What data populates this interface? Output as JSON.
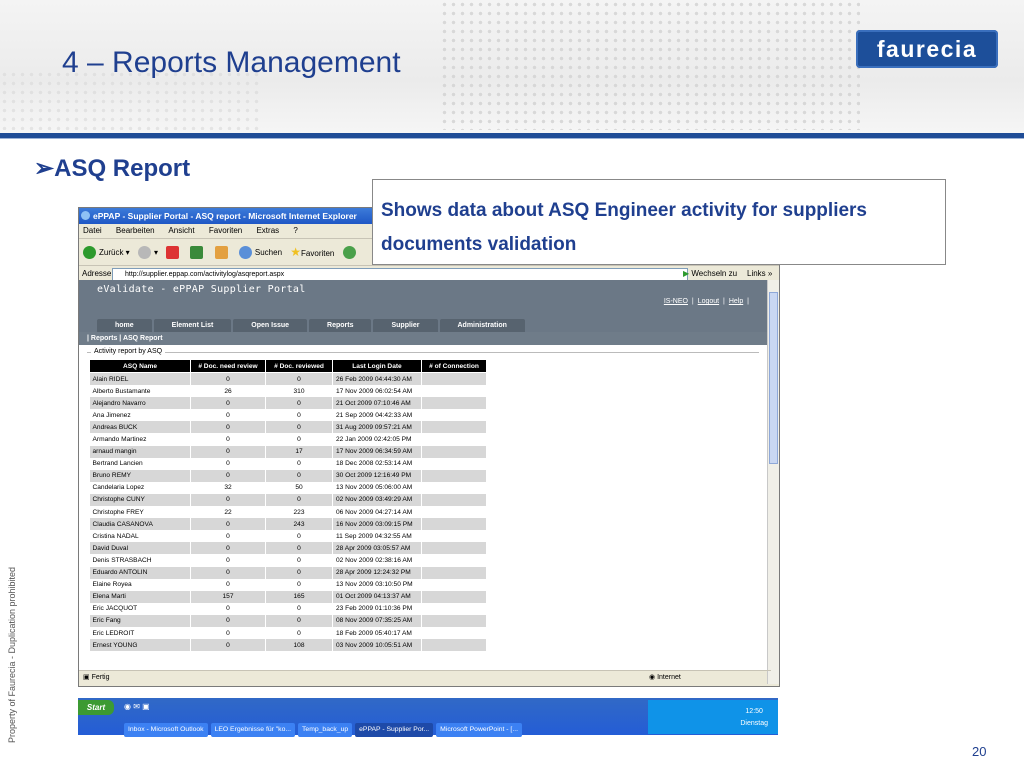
{
  "slide": {
    "title": "4 – Reports Management",
    "logo_text": "faurecia",
    "bullet": "ASQ Report",
    "side_text": "Property of Faurecia - Duplication prohibited",
    "page_number": "20",
    "callout_text": "Shows data about ASQ Engineer activity for suppliers documents validation",
    "colors": {
      "title": "#1f3f8f",
      "rule": "#1f4c96",
      "logo": "#1d4f9a"
    }
  },
  "browser": {
    "title": "ePPAP - Supplier Portal - ASQ report - Microsoft Internet Explorer",
    "menu": [
      "Datei",
      "Bearbeiten",
      "Ansicht",
      "Favoriten",
      "Extras",
      "?"
    ],
    "toolbar": {
      "back": "Zurück",
      "search": "Suchen",
      "favorites": "Favoriten"
    },
    "address_label": "Adresse",
    "address": "http://supplier.eppap.com/activitylog/asqreport.aspx",
    "go_label": "Wechseln zu",
    "links_label": "Links",
    "status": "Fertig",
    "zone": "Internet"
  },
  "portal": {
    "title": "eValidate - ePPAP Supplier Portal",
    "user": "IS-NEO",
    "logout": "Logout",
    "help": "Help",
    "tabs": [
      "home",
      "Element List",
      "Open Issue",
      "Reports",
      "Supplier",
      "Administration"
    ],
    "breadcrumb": "| Reports | ASQ Report",
    "section_legend": "Activity report by ASQ"
  },
  "table": {
    "columns": [
      "ASQ Name",
      "# Doc. need review",
      "# Doc. reviewed",
      "Last Login Date",
      "# of Connection"
    ],
    "rows": [
      [
        "Alain RIDEL",
        "0",
        "0",
        "26 Feb 2009 04:44:30 AM",
        ""
      ],
      [
        "Alberto Bustamante",
        "26",
        "310",
        "17 Nov 2009 06:02:54 AM",
        ""
      ],
      [
        "Alejandro Navarro",
        "0",
        "0",
        "21 Oct 2009 07:10:46 AM",
        ""
      ],
      [
        "Ana Jimenez",
        "0",
        "0",
        "21 Sep 2009 04:42:33 AM",
        ""
      ],
      [
        "Andreas BUCK",
        "0",
        "0",
        "31 Aug 2009 09:57:21 AM",
        ""
      ],
      [
        "Armando Martinez",
        "0",
        "0",
        "22 Jan 2009 02:42:05 PM",
        ""
      ],
      [
        "arnaud mangin",
        "0",
        "17",
        "17 Nov 2009 06:34:59 AM",
        ""
      ],
      [
        "Bertrand Lancien",
        "0",
        "0",
        "18 Dec 2008 02:53:14 AM",
        ""
      ],
      [
        "Bruno REMY",
        "0",
        "0",
        "30 Oct 2009 12:16:49 PM",
        ""
      ],
      [
        "Candelaria Lopez",
        "32",
        "50",
        "13 Nov 2009 05:06:00 AM",
        ""
      ],
      [
        "Christophe CUNY",
        "0",
        "0",
        "02 Nov 2009 03:49:29 AM",
        ""
      ],
      [
        "Christophe FREY",
        "22",
        "223",
        "06 Nov 2009 04:27:14 AM",
        ""
      ],
      [
        "Claudia CASANOVA",
        "0",
        "243",
        "16 Nov 2009 03:09:15 PM",
        ""
      ],
      [
        "Cristina NADAL",
        "0",
        "0",
        "11 Sep 2009 04:32:55 AM",
        ""
      ],
      [
        "David Duval",
        "0",
        "0",
        "28 Apr 2009 03:05:57 AM",
        ""
      ],
      [
        "Denis STRASBACH",
        "0",
        "0",
        "02 Nov 2009 02:38:16 AM",
        ""
      ],
      [
        "Eduardo ANTOLIN",
        "0",
        "0",
        "28 Apr 2009 12:24:32 PM",
        ""
      ],
      [
        "Elaine Royea",
        "0",
        "0",
        "13 Nov 2009 03:10:50 PM",
        ""
      ],
      [
        "Elena Marti",
        "157",
        "165",
        "01 Oct 2009 04:13:37 AM",
        ""
      ],
      [
        "Eric JACQUOT",
        "0",
        "0",
        "23 Feb 2009 01:10:36 PM",
        ""
      ],
      [
        "Eric Fang",
        "0",
        "0",
        "08 Nov 2009 07:35:25 AM",
        ""
      ],
      [
        "Eric LEDROIT",
        "0",
        "0",
        "18 Feb 2009 05:40:17 AM",
        ""
      ],
      [
        "Ernest YOUNG",
        "0",
        "108",
        "03 Nov 2009 10:05:51 AM",
        ""
      ]
    ]
  },
  "taskbar": {
    "start": "Start",
    "tasks": [
      "Inbox - Microsoft Outlook",
      "LEO Ergebnisse für \"ko...",
      "Temp_back_up",
      "ePPAP - Supplier Por...",
      "Microsoft PowerPoint - [..."
    ],
    "clock_time": "12:50",
    "clock_day": "Dienstag"
  }
}
